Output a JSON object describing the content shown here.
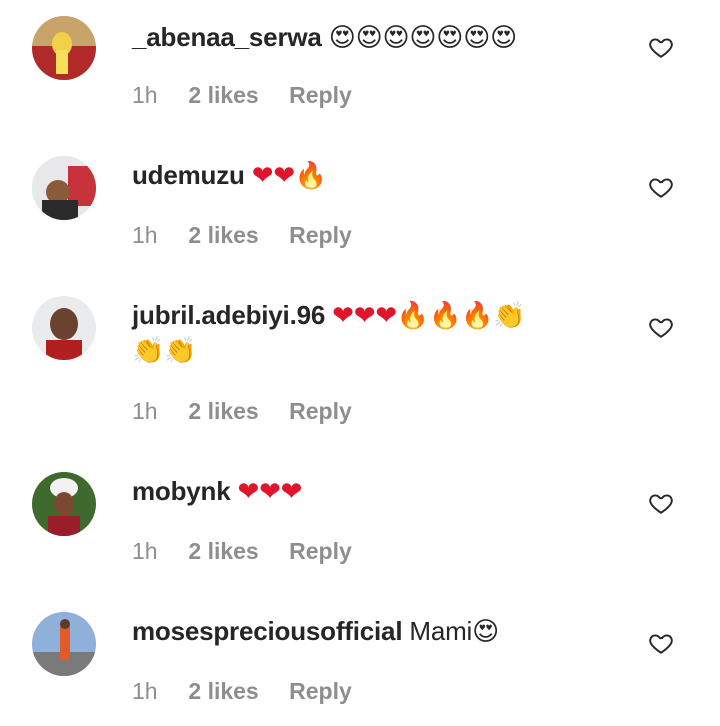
{
  "comments": [
    {
      "username": "_abenaa_serwa",
      "text": "",
      "emoji": "😍😍😍😍😍😍😍",
      "emoji2": "",
      "time": "1h",
      "likes": "2 likes",
      "reply": "Reply"
    },
    {
      "username": "udemuzu",
      "text": "",
      "emoji": "❤❤🔥",
      "emoji2": "",
      "time": "1h",
      "likes": "2 likes",
      "reply": "Reply"
    },
    {
      "username": "jubril.adebiyi.96",
      "text": "",
      "emoji": "❤❤❤🔥🔥🔥👏",
      "emoji2": "👏👏",
      "time": "1h",
      "likes": "2 likes",
      "reply": "Reply"
    },
    {
      "username": "mobynk",
      "text": "",
      "emoji": "❤❤❤",
      "emoji2": "",
      "time": "1h",
      "likes": "2 likes",
      "reply": "Reply"
    },
    {
      "username": "mosespreciousofficial",
      "text": "Mami",
      "emoji": "😍",
      "emoji2": "",
      "time": "1h",
      "likes": "2 likes",
      "reply": "Reply"
    }
  ],
  "colors": {
    "primary_text": "#262626",
    "secondary_text": "#8e8e8e",
    "heart_red": "#e0142a"
  },
  "icons": {
    "like": "heart-outline-icon"
  }
}
